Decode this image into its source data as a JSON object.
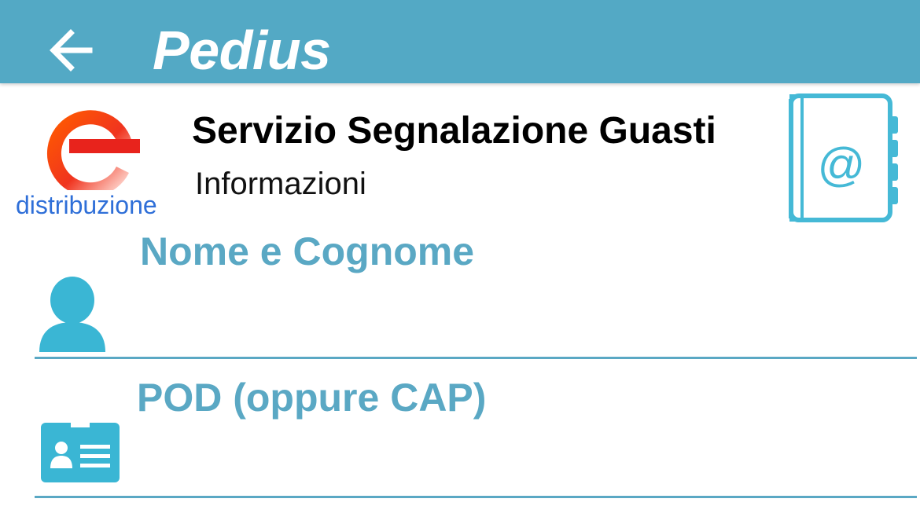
{
  "appbar": {
    "title": "Pedius",
    "background_color": "#53a9c5",
    "back_icon": "arrow-left-icon"
  },
  "provider": {
    "logo_text": "distribuzione",
    "logo_icon": "e-distribuzione-logo",
    "service_title": "Servizio Segnalazione Guasti",
    "service_subtitle": "Informazioni",
    "contacts_icon": "address-book-at-icon"
  },
  "form": {
    "fields": [
      {
        "label": "Nome e Cognome",
        "icon": "person-icon",
        "value": ""
      },
      {
        "label": "POD (oppure CAP)",
        "icon": "id-card-icon",
        "value": ""
      }
    ],
    "accent_color": "#5aa8c4"
  }
}
